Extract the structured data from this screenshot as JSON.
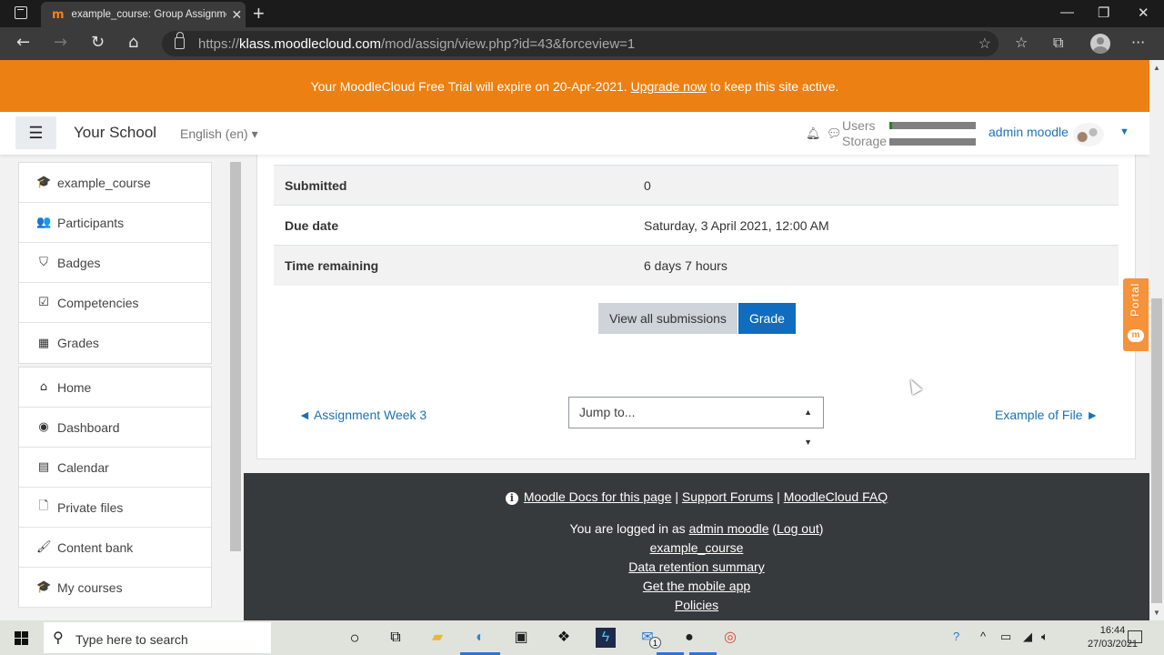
{
  "browser": {
    "tab_title": "example_course: Group Assignment",
    "tab_favicon": "moodle-icon",
    "url_scheme": "https://",
    "url_host": "klass.moodlecloud.com",
    "url_path": "/mod/assign/view.php?id=43&forceview=1",
    "new_tab_label": "+",
    "minimize_label": "—",
    "restore_label": "❐",
    "close_label": "✕"
  },
  "banner": {
    "text_before": "Your MoodleCloud Free Trial will expire on 20-Apr-2021. ",
    "link": "Upgrade now",
    "text_after": " to keep this site active.",
    "color": "#ec8012"
  },
  "navbar": {
    "site_name": "Your School",
    "language": "English (en) ▾",
    "usage": {
      "users_label": "Users",
      "storage_label": "Storage",
      "users_fraction": 0.03,
      "storage_fraction": 0.0
    },
    "user_name": "admin moodle"
  },
  "drawer": {
    "course_items": [
      {
        "label": "example_course",
        "icon": "graduation-cap-icon",
        "glyph": "🎓"
      },
      {
        "label": "Participants",
        "icon": "users-icon",
        "glyph": "👥"
      },
      {
        "label": "Badges",
        "icon": "shield-icon",
        "glyph": "⛉"
      },
      {
        "label": "Competencies",
        "icon": "checkbox-icon",
        "glyph": "☑"
      },
      {
        "label": "Grades",
        "icon": "table-icon",
        "glyph": "▦"
      }
    ],
    "site_items": [
      {
        "label": "Home",
        "icon": "home-icon",
        "glyph": "⌂"
      },
      {
        "label": "Dashboard",
        "icon": "dashboard-icon",
        "glyph": "◉"
      },
      {
        "label": "Calendar",
        "icon": "calendar-icon",
        "glyph": "▤"
      },
      {
        "label": "Private files",
        "icon": "file-icon",
        "glyph": "🗋"
      },
      {
        "label": "Content bank",
        "icon": "paintbrush-icon",
        "glyph": "🖌"
      },
      {
        "label": "My courses",
        "icon": "graduation-cap-icon",
        "glyph": "🎓"
      }
    ]
  },
  "grading_summary": {
    "rows": [
      {
        "label": "Submitted",
        "value": "0"
      },
      {
        "label": "Due date",
        "value": "Saturday, 3 April 2021, 12:00 AM"
      },
      {
        "label": "Time remaining",
        "value": "6 days 7 hours"
      }
    ],
    "view_all_label": "View all submissions",
    "grade_label": "Grade"
  },
  "activity_nav": {
    "prev_label": "◄ Assignment Week 3",
    "jump_placeholder": "Jump to...",
    "next_label": "Example of File ►"
  },
  "footer": {
    "docs_link": "Moodle Docs for this page",
    "forums_link": "Support Forums",
    "faq_link": "MoodleCloud FAQ",
    "separator": " | ",
    "logged_in_text": "You are logged in as ",
    "user_link": "admin moodle",
    "logout_link": "Log out",
    "course_link": "example_course",
    "data_retention_link": "Data retention summary",
    "mobile_app_link": "Get the mobile app",
    "policies_link": "Policies"
  },
  "portal_tab": {
    "label": "Portal"
  },
  "taskbar": {
    "search_placeholder": "Type here to search",
    "mail_badge": "1",
    "time": "16:44",
    "date": "27/03/2021"
  }
}
